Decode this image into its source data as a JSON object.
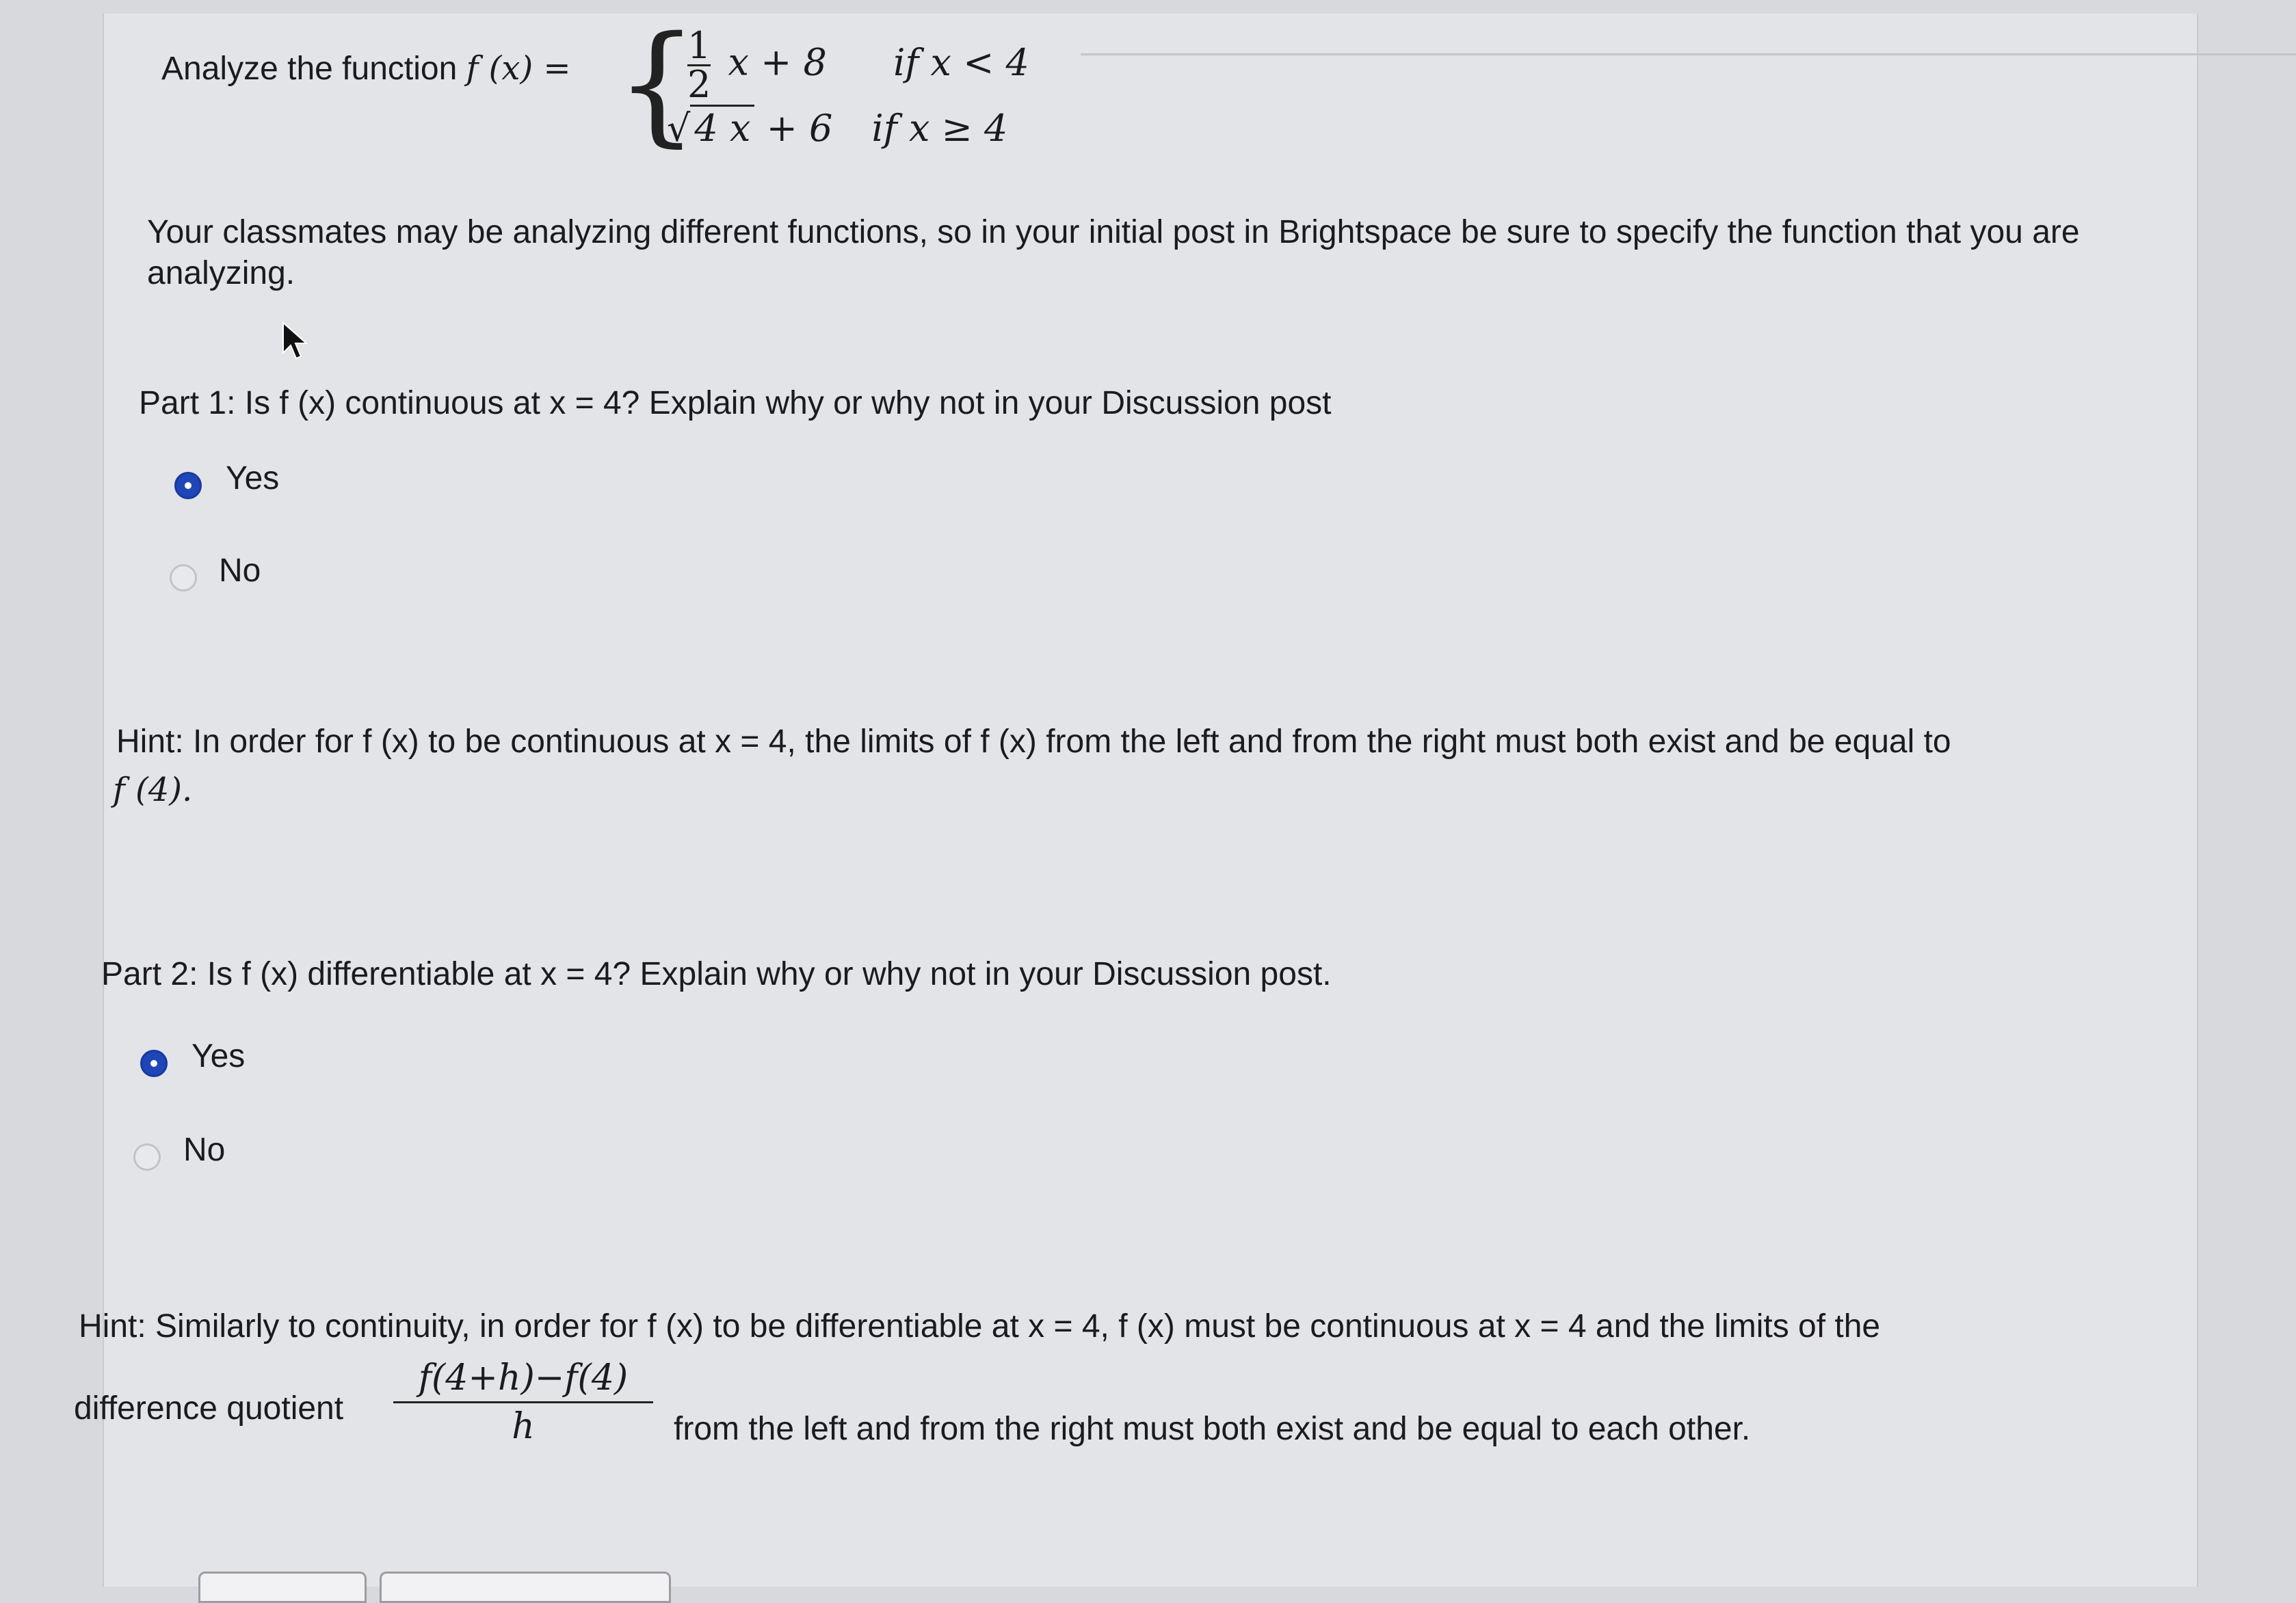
{
  "function": {
    "label": "Analyze the function",
    "lhs": "f (x) =",
    "piece1_frac_num": "1",
    "piece1_frac_den": "2",
    "piece1_expr": "x + 8",
    "piece1_cond": "if  x < 4",
    "piece2_sqrt": "4 x",
    "piece2_expr": "+ 6",
    "piece2_cond": "if  x ≥ 4"
  },
  "instructions": "Your classmates may be analyzing different functions, so in your initial post in Brightspace be sure to specify the function that you are analyzing.",
  "part1": {
    "question": "Part 1: Is f (x) continuous at x  =  4? Explain why or why not in your Discussion post",
    "options": [
      {
        "label": "Yes",
        "selected": true
      },
      {
        "label": "No",
        "selected": false
      }
    ],
    "hint": "Hint: In order for f (x) to be continuous at x = 4, the limits of f (x) from the left and from the right must both exist and be equal to",
    "hint_end": "f (4)."
  },
  "part2": {
    "question": "Part 2: Is f (x) differentiable at x = 4? Explain why or why not in your Discussion post.",
    "options": [
      {
        "label": "Yes",
        "selected": true
      },
      {
        "label": "No",
        "selected": false
      }
    ],
    "hint_line1": "Hint: Similarly to continuity, in order for f (x) to be differentiable at x = 4, f (x) must be continuous at x = 4 and the limits of the",
    "hint_prefix": "difference quotient",
    "dq_numerator": "f(4+h)−f(4)",
    "dq_denominator": "h",
    "hint_suffix": "from the left and from the right must both exist and be equal to each other."
  }
}
